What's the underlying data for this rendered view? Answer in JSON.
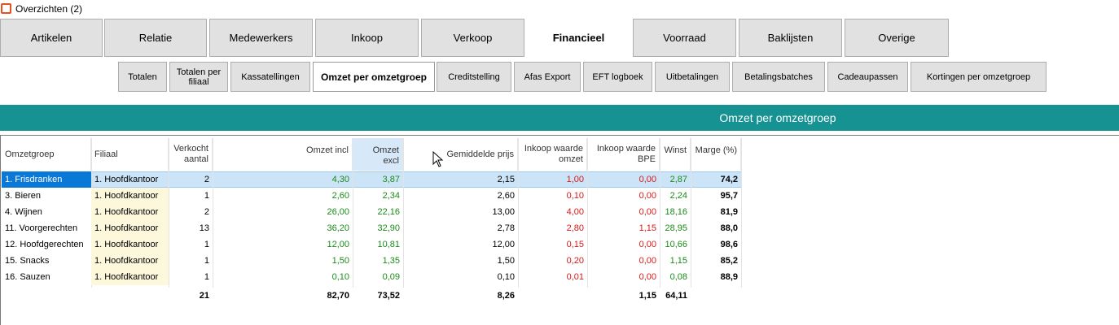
{
  "window": {
    "title": "Overzichten (2)"
  },
  "main_tabs": [
    {
      "label": "Artikelen"
    },
    {
      "label": "Relatie"
    },
    {
      "label": "Medewerkers"
    },
    {
      "label": "Inkoop"
    },
    {
      "label": "Verkoop"
    },
    {
      "label": "Financieel"
    },
    {
      "label": "Voorraad"
    },
    {
      "label": "Baklijsten"
    },
    {
      "label": "Overige"
    }
  ],
  "sub_tabs": [
    {
      "label": "Totalen"
    },
    {
      "label": "Totalen per filiaal"
    },
    {
      "label": "Kassatellingen"
    },
    {
      "label": "Omzet per omzetgroep"
    },
    {
      "label": "Creditstelling"
    },
    {
      "label": "Afas Export"
    },
    {
      "label": "EFT logboek"
    },
    {
      "label": "Uitbetalingen"
    },
    {
      "label": "Betalingsbatches"
    },
    {
      "label": "Cadeaupassen"
    },
    {
      "label": "Kortingen per omzetgroep"
    }
  ],
  "banner": {
    "title": "Omzet per omzetgroep"
  },
  "table": {
    "headers": {
      "omzetgroep": "Omzetgroep",
      "filiaal": "Filiaal",
      "verkocht": "Verkocht aantal",
      "omzet_incl": "Omzet incl",
      "omzet_excl": "Omzet excl",
      "gem_prijs": "Gemiddelde prijs",
      "inkoop_omzet": "Inkoop waarde omzet",
      "inkoop_bpe": "Inkoop waarde BPE",
      "winst": "Winst",
      "marge": "Marge (%)"
    },
    "rows": [
      {
        "omzetgroep": "1. Frisdranken",
        "filiaal": "1. Hoofdkantoor",
        "verkocht": "2",
        "omzet_incl": "4,30",
        "omzet_excl": "3,87",
        "gem_prijs": "2,15",
        "inkoop_omzet": "1,00",
        "inkoop_bpe": "0,00",
        "winst": "2,87",
        "marge": "74,2"
      },
      {
        "omzetgroep": "3. Bieren",
        "filiaal": "1. Hoofdkantoor",
        "verkocht": "1",
        "omzet_incl": "2,60",
        "omzet_excl": "2,34",
        "gem_prijs": "2,60",
        "inkoop_omzet": "0,10",
        "inkoop_bpe": "0,00",
        "winst": "2,24",
        "marge": "95,7"
      },
      {
        "omzetgroep": "4. Wijnen",
        "filiaal": "1. Hoofdkantoor",
        "verkocht": "2",
        "omzet_incl": "26,00",
        "omzet_excl": "22,16",
        "gem_prijs": "13,00",
        "inkoop_omzet": "4,00",
        "inkoop_bpe": "0,00",
        "winst": "18,16",
        "marge": "81,9"
      },
      {
        "omzetgroep": "11. Voorgerechten",
        "filiaal": "1. Hoofdkantoor",
        "verkocht": "13",
        "omzet_incl": "36,20",
        "omzet_excl": "32,90",
        "gem_prijs": "2,78",
        "inkoop_omzet": "2,80",
        "inkoop_bpe": "1,15",
        "winst": "28,95",
        "marge": "88,0"
      },
      {
        "omzetgroep": "12. Hoofdgerechten",
        "filiaal": "1. Hoofdkantoor",
        "verkocht": "1",
        "omzet_incl": "12,00",
        "omzet_excl": "10,81",
        "gem_prijs": "12,00",
        "inkoop_omzet": "0,15",
        "inkoop_bpe": "0,00",
        "winst": "10,66",
        "marge": "98,6"
      },
      {
        "omzetgroep": "15. Snacks",
        "filiaal": "1. Hoofdkantoor",
        "verkocht": "1",
        "omzet_incl": "1,50",
        "omzet_excl": "1,35",
        "gem_prijs": "1,50",
        "inkoop_omzet": "0,20",
        "inkoop_bpe": "0,00",
        "winst": "1,15",
        "marge": "85,2"
      },
      {
        "omzetgroep": "16. Sauzen",
        "filiaal": "1. Hoofdkantoor",
        "verkocht": "1",
        "omzet_incl": "0,10",
        "omzet_excl": "0,09",
        "gem_prijs": "0,10",
        "inkoop_omzet": "0,01",
        "inkoop_bpe": "0,00",
        "winst": "0,08",
        "marge": "88,9"
      }
    ],
    "totals": {
      "verkocht": "21",
      "omzet_incl": "82,70",
      "omzet_excl": "73,52",
      "gem_prijs": "8,26",
      "inkoop_bpe": "1,15",
      "winst": "64,11"
    }
  },
  "colors": {
    "banner": "#179292",
    "positive": "#1a8a1a",
    "negative": "#d81818",
    "selection": "#0a78d7"
  },
  "icons": {
    "app": "overview-window-icon",
    "cursor": "mouse-pointer-icon"
  }
}
